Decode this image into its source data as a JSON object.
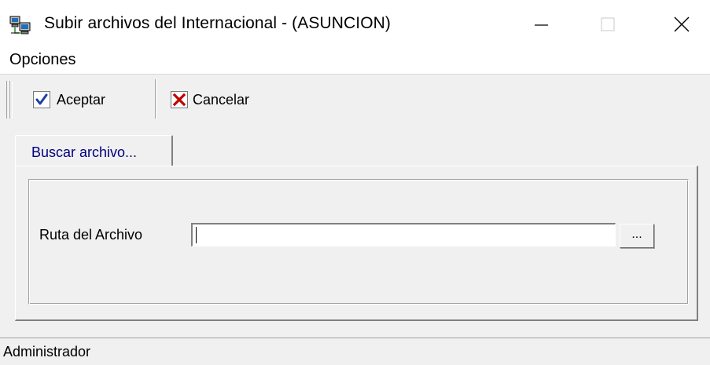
{
  "window": {
    "title": "Subir archivos del Internacional - (ASUNCION)",
    "icon": "network-computers-icon",
    "controls": [
      "minimize-icon",
      "maximize-icon",
      "close-icon"
    ]
  },
  "menu": {
    "items": [
      {
        "label": "Opciones"
      }
    ]
  },
  "toolbar": {
    "accept_label": "Aceptar",
    "accept_icon": "check-icon",
    "cancel_label": "Cancelar",
    "cancel_icon": "x-cross-icon"
  },
  "tabs": [
    {
      "label": "Buscar archivo...",
      "active": true
    }
  ],
  "form": {
    "path_label": "Ruta del Archivo",
    "path_value": "",
    "browse_label": "..."
  },
  "status": {
    "user": "Administrador"
  },
  "colors": {
    "window_bg": "#f0f0f0",
    "tab_text": "#000080",
    "check": "#1e3fa8",
    "cross": "#c00000"
  }
}
